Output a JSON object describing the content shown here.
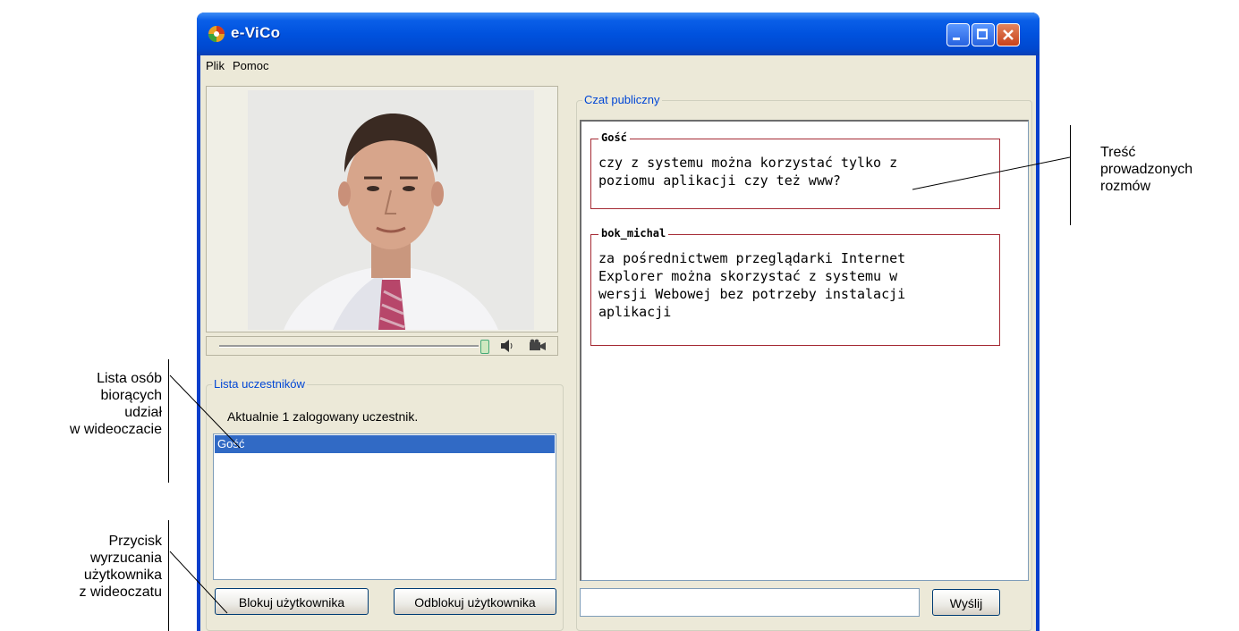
{
  "window": {
    "title": "e-ViCo",
    "menu": [
      "Plik",
      "Pomoc"
    ]
  },
  "participants": {
    "legend": "Lista uczestników",
    "count_text": "Aktualnie 1 zalogowany uczestnik.",
    "items": [
      "Gość"
    ],
    "block_button": "Blokuj użytkownika",
    "unblock_button": "Odblokuj użytkownika"
  },
  "chat": {
    "legend": "Czat publiczny",
    "messages": [
      {
        "author": "Gość",
        "lines": [
          "czy z systemu można korzystać tylko z",
          "poziomu aplikacji czy też www?"
        ]
      },
      {
        "author": "bok_michal",
        "lines": [
          "za pośrednictwem przeglądarki Internet",
          "Explorer można skorzystać z systemu w",
          "wersji Webowej bez potrzeby instalacji",
          "aplikacji"
        ]
      }
    ],
    "input_value": "",
    "send_button": "Wyślij"
  },
  "annotations": {
    "chat_content": [
      "Treść",
      "prowadzonych",
      "rozmów"
    ],
    "participants_list": [
      "Lista osób",
      "biorących",
      "udział",
      "w  wideoczacie"
    ],
    "kick_button": [
      "Przycisk",
      "wyrzucania",
      "użytkownika",
      "z wideoczatu"
    ]
  },
  "colors": {
    "titlebar": "#0054e3",
    "selection": "#316ac5",
    "message_border": "#a52a34",
    "legend_text": "#0046d5"
  },
  "icons": [
    "app-logo-icon",
    "minimize-icon",
    "maximize-icon",
    "close-icon",
    "speaker-icon",
    "camera-icon"
  ]
}
